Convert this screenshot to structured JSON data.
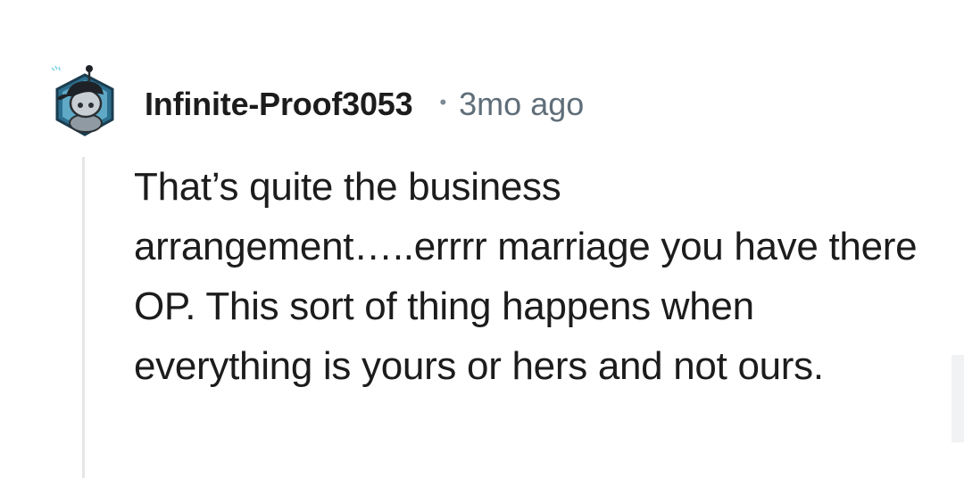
{
  "comment": {
    "author": "Infinite-Proof3053",
    "separator": "•",
    "time_ago": "3mo ago",
    "body": "That’s quite the business arrangement…..errrr marriage you have there OP. This sort of thing happens when everything is yours or hers and not ours."
  },
  "avatar": {
    "icon": "snoo-avatar-icon",
    "colors": {
      "badge": "#2c6f8f",
      "head": "#c7cfd4",
      "cap": "#1e2226"
    }
  },
  "theme": {
    "text": "#1c1c1c",
    "meta": "#5f6e79",
    "thread_line": "#e4e6e8",
    "background": "#ffffff"
  }
}
